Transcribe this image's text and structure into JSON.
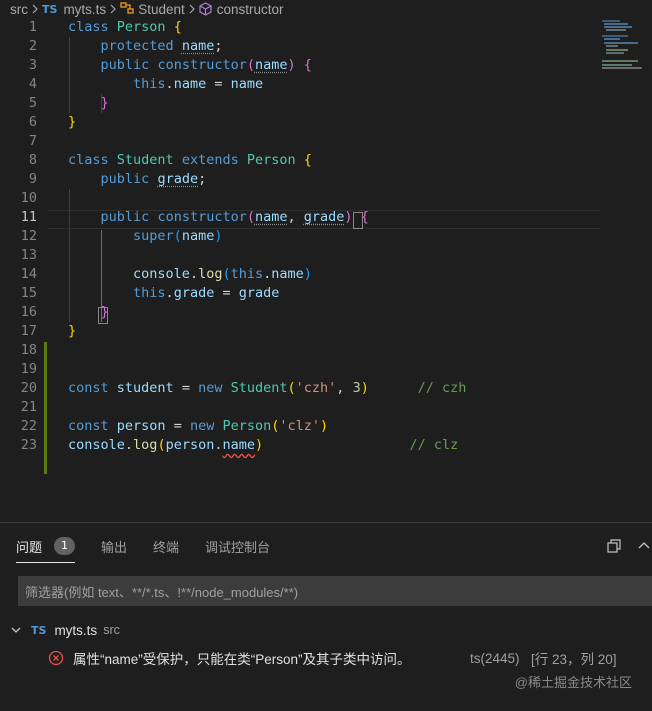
{
  "breadcrumb": {
    "folder": "src",
    "file_badge": "TS",
    "file": "myts.ts",
    "class_name": "Student",
    "method": "constructor"
  },
  "editor": {
    "line_numbers": [
      "1",
      "2",
      "3",
      "4",
      "5",
      "6",
      "7",
      "8",
      "9",
      "10",
      "11",
      "12",
      "13",
      "14",
      "15",
      "16",
      "17",
      "18",
      "19",
      "20",
      "21",
      "22",
      "23"
    ],
    "active_line": "11",
    "lines": {
      "l1": {
        "kw": "class",
        "cls": "Person",
        "brace": "{"
      },
      "l2": {
        "kw": "protected",
        "prop": "name",
        "semi": ";"
      },
      "l3": {
        "kw": "public",
        "fn": "constructor",
        "paren_open": "(",
        "param": "name",
        "paren_close": ")",
        "brace": "{"
      },
      "l4": {
        "this": "this",
        "dot": ".",
        "prop": "name",
        "eq": " = ",
        "val": "name"
      },
      "l5": {
        "brace": "}"
      },
      "l6": {
        "brace": "}"
      },
      "l8": {
        "kw": "class",
        "cls": "Student",
        "kw2": "extends",
        "cls2": "Person",
        "brace": "{"
      },
      "l9": {
        "kw": "public",
        "prop": "grade",
        "semi": ";"
      },
      "l11": {
        "kw": "public",
        "fn": "constructor",
        "paren_open": "(",
        "param1": "name",
        "comma": ", ",
        "param2": "grade",
        "paren_close": ")",
        "brace": "{"
      },
      "l12": {
        "fn": "super",
        "paren_open": "(",
        "arg": "name",
        "paren_close": ")"
      },
      "l14": {
        "obj": "console",
        "dot": ".",
        "fn": "log",
        "paren_open": "(",
        "this": "this",
        "dot2": ".",
        "prop": "name",
        "paren_close": ")"
      },
      "l15": {
        "this": "this",
        "dot": ".",
        "prop": "grade",
        "eq": " = ",
        "val": "grade"
      },
      "l16": {
        "brace": "}"
      },
      "l17": {
        "brace": "}"
      },
      "l20": {
        "kw": "const",
        "var": "student",
        "eq": " = ",
        "new": "new",
        "cls": "Student",
        "paren_open": "(",
        "str": "'czh'",
        "comma": ", ",
        "num": "3",
        "paren_close": ")",
        "comment": "// czh"
      },
      "l22": {
        "kw": "const",
        "var": "person",
        "eq": " = ",
        "new": "new",
        "cls": "Person",
        "paren_open": "(",
        "str": "'clz'",
        "paren_close": ")"
      },
      "l23": {
        "obj": "console",
        "dot": ".",
        "fn": "log",
        "paren_open": "(",
        "var": "person",
        "dot2": ".",
        "prop": "name",
        "paren_close": ")",
        "comment": "// clz"
      }
    }
  },
  "panel": {
    "tabs": [
      "问题",
      "输出",
      "终端",
      "调试控制台"
    ],
    "problem_count": "1",
    "filter_placeholder": "筛选器(例如 text、**/*.ts、!**/node_modules/**)",
    "file_badge": "TS",
    "file_name": "myts.ts",
    "file_dir": "src",
    "problem": {
      "message": "属性“name”受保护，只能在类“Person”及其子类中访问。",
      "code": "ts(2445)",
      "location": "[行 23，列 20]"
    }
  },
  "watermark": "@稀土掘金技术社区",
  "colors": {
    "background": "#1e1e1e",
    "keyword": "#569cd6",
    "class": "#4ec9b0",
    "function": "#dcdcaa",
    "variable": "#9cdcfe",
    "string": "#ce9178",
    "number": "#b5cea8",
    "comment": "#6a9955",
    "error": "#f14c4c",
    "ts_badge": "#4f9ad6"
  },
  "icons": [
    "chevron-right-icon",
    "class-icon",
    "method-cube-icon",
    "chevron-down-icon",
    "error-circle-icon",
    "restore-panel-icon",
    "chevron-up-icon"
  ]
}
